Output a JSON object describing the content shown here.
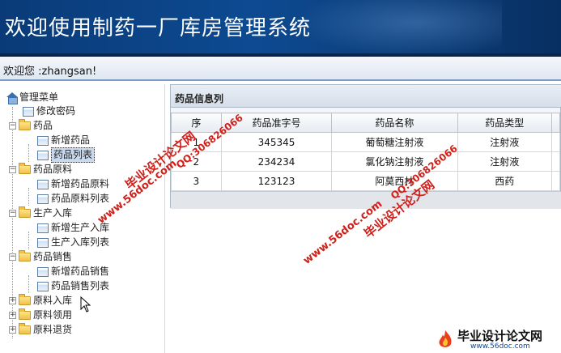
{
  "app": {
    "title": "欢迎使用制药一厂库房管理系统"
  },
  "welcome": {
    "text": "欢迎您 :zhangsan!"
  },
  "tree": {
    "root": "管理菜单",
    "items": [
      {
        "label": "修改密码"
      },
      {
        "label": "药品"
      },
      {
        "label": "新增药品"
      },
      {
        "label": "药品列表"
      },
      {
        "label": "药品原料"
      },
      {
        "label": "新增药品原料"
      },
      {
        "label": "药品原料列表"
      },
      {
        "label": "生产入库"
      },
      {
        "label": "新增生产入库"
      },
      {
        "label": "生产入库列表"
      },
      {
        "label": "药品销售"
      },
      {
        "label": "新增药品销售"
      },
      {
        "label": "药品销售列表"
      },
      {
        "label": "原料入库"
      },
      {
        "label": "原料领用"
      },
      {
        "label": "原料退货"
      }
    ]
  },
  "panel": {
    "title": "药品信息列"
  },
  "table": {
    "headers": [
      "序",
      "药品准字号",
      "药品名称",
      "药品类型"
    ],
    "rows": [
      [
        "1",
        "345345",
        "葡萄糖注射液",
        "注射液"
      ],
      [
        "2",
        "234234",
        "氯化钠注射液",
        "注射液"
      ],
      [
        "3",
        "123123",
        "阿莫西林",
        "西药"
      ]
    ]
  },
  "watermarks": {
    "site": "www.56doc.com",
    "qq": "QQ:306826066",
    "name": "毕业设计论文网",
    "logo_text": "毕业设计论文网",
    "logo_url": "www.56doc.com"
  }
}
